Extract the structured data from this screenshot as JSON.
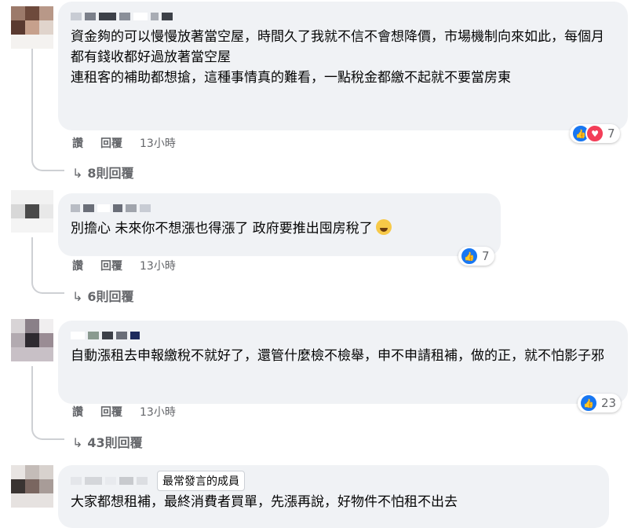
{
  "comments": [
    {
      "text": "資金夠的可以慢慢放著當空屋，時間久了我就不信不會想降價，市場機制向來如此，每個月都有錢收都好過放著當空屋\n連租客的補助都想搶，這種事情真的難看，一點稅金都繳不起就不要當房東",
      "like_label": "讚",
      "reply_label": "回覆",
      "time": "13小時",
      "reaction_count": "7",
      "reaction_types": [
        "like-icon",
        "love-icon"
      ],
      "replies_label": "8則回覆"
    },
    {
      "text": "別擔心 未來你不想漲也得漲了 政府要推出囤房稅了",
      "like_label": "讚",
      "reply_label": "回覆",
      "time": "13小時",
      "reaction_count": "7",
      "reaction_types": [
        "like-icon"
      ],
      "replies_label": "6則回覆"
    },
    {
      "text": "自動漲租去申報繳稅不就好了，還管什麼檢不檢舉，申不申請租補，做的正，就不怕影子邪",
      "like_label": "讚",
      "reply_label": "回覆",
      "time": "13小時",
      "reaction_count": "23",
      "reaction_types": [
        "like-icon"
      ],
      "replies_label": "43則回覆"
    },
    {
      "badge": "最常發言的成員",
      "text": "大家都想租補，最終消費者買單，先漲再說，好物件不怕租不出去"
    }
  ],
  "colors": {
    "bubble": "#f0f2f5",
    "like": "#1877f2",
    "love": "#f33e58",
    "secondary_text": "#65676b"
  }
}
